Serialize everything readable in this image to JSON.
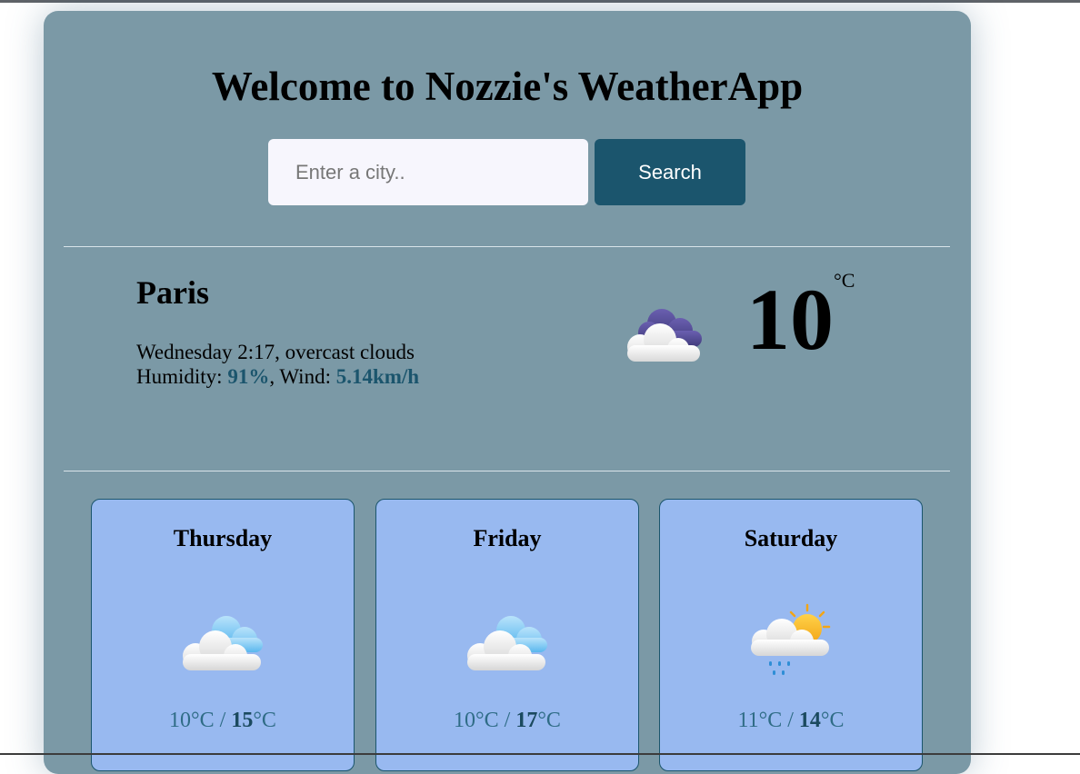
{
  "header": {
    "title": "Welcome to Nozzie's WeatherApp"
  },
  "search": {
    "placeholder": "Enter a city..",
    "value": "",
    "button_label": "Search"
  },
  "current": {
    "city": "Paris",
    "description": "Wednesday 2:17, overcast clouds",
    "humidity_label": "Humidity: ",
    "humidity": "91%",
    "wind_label": ", Wind: ",
    "wind": "5.14km/h",
    "temperature": "10",
    "unit": "°C",
    "icon": "overcast-clouds-icon"
  },
  "forecast": [
    {
      "day": "Thursday",
      "min": "10°C",
      "separator": " / ",
      "max": "15",
      "max_unit": "°C",
      "icon": "cloudy-icon"
    },
    {
      "day": "Friday",
      "min": "10°C",
      "separator": " / ",
      "max": "17",
      "max_unit": "°C",
      "icon": "cloudy-icon"
    },
    {
      "day": "Saturday",
      "min": "11°C",
      "separator": " / ",
      "max": "14",
      "max_unit": "°C",
      "icon": "sun-rain-icon"
    }
  ],
  "colors": {
    "app_background": "#7b99a6",
    "accent": "#1b556d",
    "card_background": "#98b9f0",
    "input_background": "#f7f6fd"
  }
}
